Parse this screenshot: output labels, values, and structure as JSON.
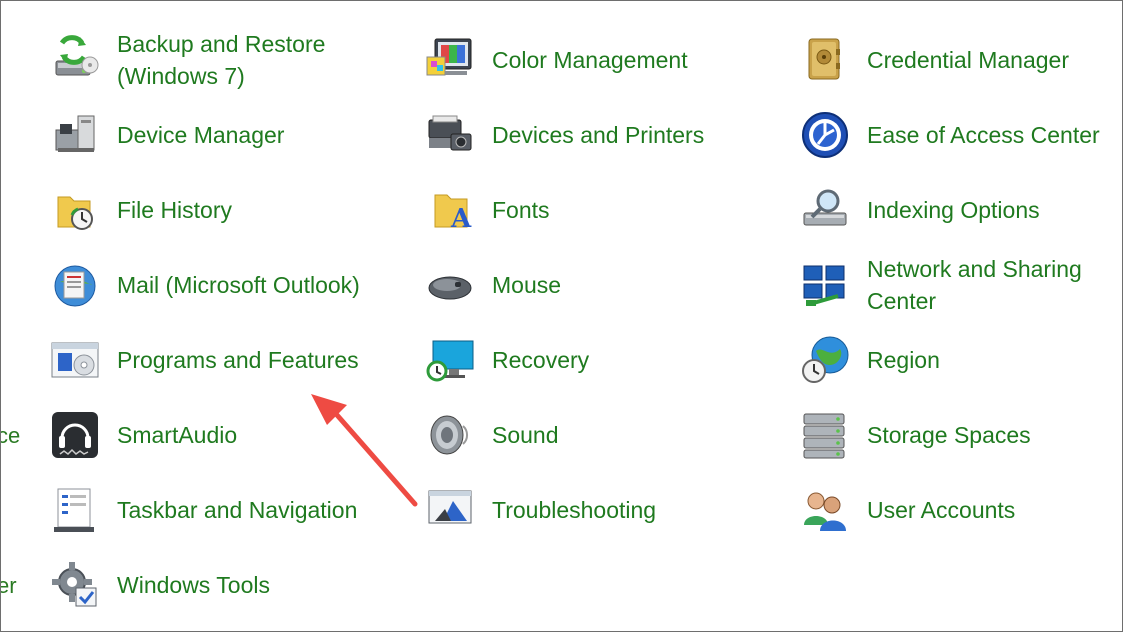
{
  "left_edge_fragments": [
    "ce",
    "er"
  ],
  "items": [
    {
      "label": "Backup and Restore (Windows 7)",
      "icon": "backup-restore-icon"
    },
    {
      "label": "Color Management",
      "icon": "color-management-icon"
    },
    {
      "label": "Credential Manager",
      "icon": "credential-vault-icon"
    },
    {
      "label": "Device Manager",
      "icon": "device-manager-icon"
    },
    {
      "label": "Devices and Printers",
      "icon": "printer-camera-icon"
    },
    {
      "label": "Ease of Access Center",
      "icon": "ease-of-access-icon"
    },
    {
      "label": "File History",
      "icon": "file-history-icon"
    },
    {
      "label": "Fonts",
      "icon": "fonts-folder-icon"
    },
    {
      "label": "Indexing Options",
      "icon": "indexing-magnifier-icon"
    },
    {
      "label": "Mail (Microsoft Outlook)",
      "icon": "mail-globe-icon"
    },
    {
      "label": "Mouse",
      "icon": "mouse-icon"
    },
    {
      "label": "Network and Sharing Center",
      "icon": "network-computers-icon"
    },
    {
      "label": "Programs and Features",
      "icon": "programs-features-icon"
    },
    {
      "label": "Recovery",
      "icon": "recovery-monitor-icon"
    },
    {
      "label": "Region",
      "icon": "region-globe-clock-icon"
    },
    {
      "label": "SmartAudio",
      "icon": "headphones-icon"
    },
    {
      "label": "Sound",
      "icon": "speaker-icon"
    },
    {
      "label": "Storage Spaces",
      "icon": "storage-drives-icon"
    },
    {
      "label": "Taskbar and Navigation",
      "icon": "taskbar-icon"
    },
    {
      "label": "Troubleshooting",
      "icon": "troubleshooting-icon"
    },
    {
      "label": "User Accounts",
      "icon": "users-icon"
    },
    {
      "label": "Windows Tools",
      "icon": "windows-tools-gear-icon"
    }
  ],
  "colors": {
    "link_text": "#1f7a1f",
    "annotation_arrow": "#ee4b43",
    "background": "#ffffff"
  }
}
